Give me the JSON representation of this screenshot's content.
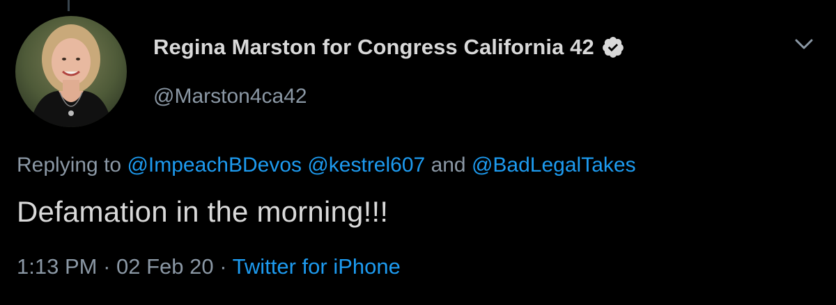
{
  "tweet": {
    "author": {
      "display_name": "Regina Marston for Congress California 42",
      "handle": "@Marston4ca42",
      "verified": true,
      "avatar_icon": "profile-photo"
    },
    "reply": {
      "prefix": "Replying to",
      "mentions": [
        "@ImpeachBDevos",
        "@kestrel607",
        "@BadLegalTakes"
      ],
      "conjunction": "and"
    },
    "text": "Defamation in the morning!!!",
    "time": "1:13 PM",
    "separator": "·",
    "date": "02 Feb 20",
    "source": "Twitter for iPhone"
  },
  "colors": {
    "background": "#000000",
    "primary_text": "#d9d9d9",
    "secondary_text": "#8b98a5",
    "link": "#1d9bf0",
    "verified_badge": "#d9d9d9"
  },
  "icons": {
    "verified": "verified-badge-icon",
    "menu": "chevron-down-icon"
  }
}
